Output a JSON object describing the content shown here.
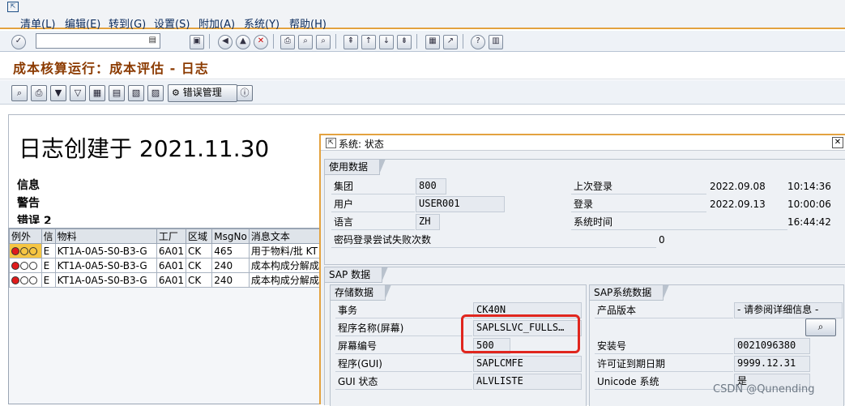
{
  "menu": {
    "items": [
      "清单(L)",
      "编辑(E)",
      "转到(G)",
      "设置(S)",
      "附加(A)",
      "系统(Y)",
      "帮助(H)"
    ]
  },
  "toolbar": {
    "command_value": "",
    "icons": [
      "check-icon",
      "save-icon",
      "back-icon",
      "exit-icon",
      "cancel-icon",
      "print-icon",
      "find-icon",
      "find-next-icon",
      "first-page-icon",
      "prev-page-icon",
      "next-page-icon",
      "last-page-icon",
      "new-session-icon",
      "shortcut-icon",
      "help-icon",
      "customize-icon"
    ]
  },
  "page": {
    "title": "成本核算运行：成本评估 - 日志"
  },
  "app_toolbar": {
    "error_mgmt_label": "错误管理"
  },
  "log": {
    "heading": "日志创建于 2021.11.30",
    "labels": [
      "信息",
      "警告",
      "错误  2"
    ]
  },
  "grid": {
    "columns": [
      "例外",
      "信",
      "物料",
      "工厂",
      "区域",
      "MsgNo",
      "消息文本"
    ],
    "rows": [
      {
        "type": "E",
        "material": "KT1A-0A5-S0-B3-G",
        "plant": "6A01",
        "area": "CK",
        "msgno": "465",
        "text": "用于物料/批 KT"
      },
      {
        "type": "E",
        "material": "KT1A-0A5-S0-B3-G",
        "plant": "6A01",
        "area": "CK",
        "msgno": "240",
        "text": "成本构成分解成"
      },
      {
        "type": "E",
        "material": "KT1A-0A5-S0-B3-G",
        "plant": "6A01",
        "area": "CK",
        "msgno": "240",
        "text": "成本构成分解成"
      }
    ],
    "status_colors": {
      "red": "#e01b1b",
      "off": "#ffffff"
    }
  },
  "dialog": {
    "title": "系统: 状态",
    "usage": {
      "tab": "使用数据",
      "client_label": "集团",
      "client": "800",
      "user_label": "用户",
      "user": "USER001",
      "lang_label": "语言",
      "lang": "ZH",
      "failed_label": "密码登录尝试失败次数",
      "failed": "0",
      "last_login_label": "上次登录",
      "last_login_date": "2022.09.08",
      "last_login_time": "10:14:36",
      "login_label": "登录",
      "login_date": "2022.09.13",
      "login_time": "10:00:06",
      "systime_label": "系统时间",
      "systime": "16:44:42"
    },
    "sap": {
      "tab": "SAP 数据",
      "storage_tab": "存储数据",
      "txn_label": "事务",
      "txn": "CK40N",
      "prog_screen_label": "程序名称(屏幕)",
      "prog_screen": "SAPLSLVC_FULLS…",
      "screen_no_label": "屏幕编号",
      "screen_no": "500",
      "prog_gui_label": "程序(GUI)",
      "prog_gui": "SAPLCMFE",
      "gui_status_label": "GUI 状态",
      "gui_status": "ALVLISTE",
      "system_tab": "SAP系统数据",
      "product_label": "产品版本",
      "product": "- 请参阅详细信息 -",
      "install_label": "安装号",
      "install": "0021096380",
      "license_label": "许可证到期日期",
      "license": "9999.12.31",
      "unicode_label": "Unicode 系统",
      "unicode": "是"
    }
  },
  "watermark": "CSDN @Qunending",
  "accent": {
    "highlight": "#e0261e",
    "active_border": "#e3a23f"
  }
}
